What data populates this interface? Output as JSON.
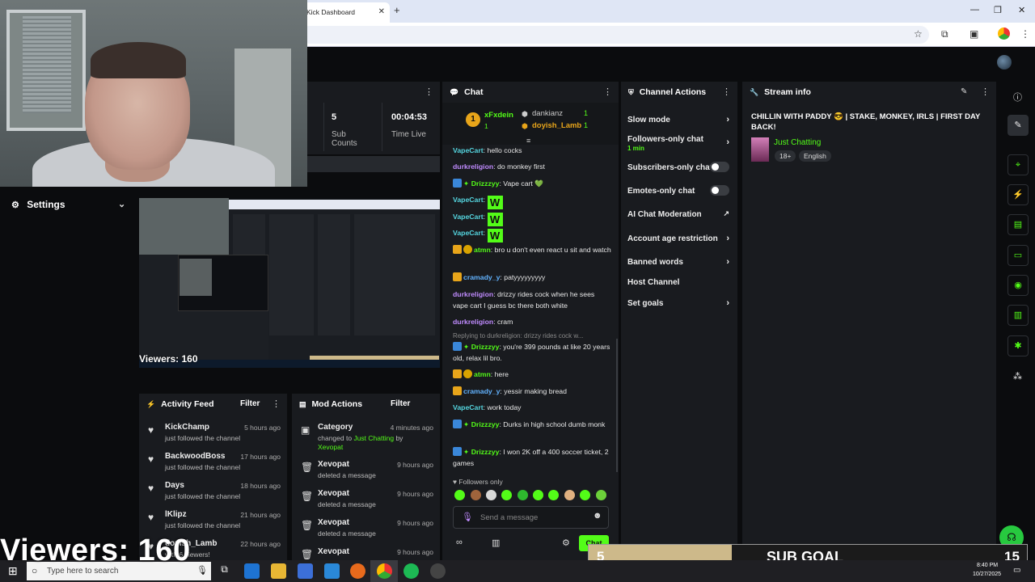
{
  "browser": {
    "tab_title": "Kick Dashboard",
    "tab_close": "✕",
    "new_tab": "+",
    "win_min": "—",
    "win_max": "❐",
    "win_close": "✕"
  },
  "settings": {
    "label": "Settings"
  },
  "preview": {
    "viewers": "Viewers: 160"
  },
  "stats": {
    "sub_counts_value": "5",
    "sub_counts_label": "Sub Counts",
    "time_live_value": "00:04:53",
    "time_live_label": "Time Live"
  },
  "activity": {
    "title": "Activity Feed",
    "filter": "Filter",
    "items": [
      {
        "name": "KickChamp",
        "sub": "just followed the channel",
        "time": "5 hours ago"
      },
      {
        "name": "BackwoodBoss",
        "sub": "just followed the channel",
        "time": "17 hours ago"
      },
      {
        "name": "Days",
        "sub": "just followed the channel",
        "time": "18 hours ago"
      },
      {
        "name": "lKlipz",
        "sub": "just followed the channel",
        "time": "21 hours ago"
      },
      {
        "name": "doyish_Lamb",
        "sub": "with 6 viewers!",
        "time": "22 hours ago"
      }
    ]
  },
  "mod": {
    "title": "Mod Actions",
    "filter": "Filter",
    "category": {
      "name": "Category",
      "time": "4 minutes ago",
      "pre": "changed to",
      "cat": "Just Chatting",
      "by": "by",
      "user": "Xevopat"
    },
    "items": [
      {
        "name": "Xevopat",
        "sub": "deleted a message",
        "time": "9 hours ago"
      },
      {
        "name": "Xevopat",
        "sub": "deleted a message",
        "time": "9 hours ago"
      },
      {
        "name": "Xevopat",
        "sub": "deleted a message",
        "time": "9 hours ago"
      },
      {
        "name": "Xevopat",
        "sub": "",
        "time": "9 hours ago"
      }
    ]
  },
  "chat": {
    "title": "Chat",
    "top_gifter": {
      "rank": "1",
      "name": "xFxdein",
      "count": "1"
    },
    "gifters": [
      {
        "name": "dankianz",
        "count": "1"
      },
      {
        "name": "doyish_Lamb",
        "count": "1"
      }
    ],
    "messages": [
      {
        "user": "VapeCart",
        "text": ": hello cocks"
      },
      {
        "user": "durkreligion",
        "text": ": do monkey first"
      },
      {
        "user": "Drizzzyy",
        "text": ": Vape cart 💚"
      },
      {
        "user": "VapeCart",
        "emote": "W"
      },
      {
        "user": "VapeCart",
        "emote": "W"
      },
      {
        "user": "VapeCart",
        "emote": "W"
      },
      {
        "user": "atmn",
        "text": ": bro u don't even react u sit and watch"
      },
      {
        "user": "cramady_y",
        "text": ": patyyyyyyyyy"
      },
      {
        "user": "durkreligion",
        "text": ": drizzy rides cock when he sees vape cart I guess bc there both white"
      },
      {
        "user": "durkreligion",
        "text": ": cram"
      },
      {
        "reply": "Replying to durkreligion: drizzy rides cock w..."
      },
      {
        "user": "Drizzzyy",
        "text": ": you're 399 pounds at like 20 years old, relax lil bro."
      },
      {
        "user": "atmn",
        "text": ": here"
      },
      {
        "user": "cramady_y",
        "text": ": yessir making bread"
      },
      {
        "user": "VapeCart",
        "text": ": work today"
      },
      {
        "user": "Drizzzyy",
        "text": ": Durks in high school dumb monk"
      },
      {
        "user": "Drizzzyy",
        "text": ": I won 2K off a 400 soccer ticket, 2 games"
      }
    ],
    "followers_only": "Followers only",
    "placeholder": "Send a message",
    "send": "Chat"
  },
  "channel_actions": {
    "title": "Channel Actions",
    "items": [
      {
        "label": "Slow mode",
        "control": "chevron"
      },
      {
        "label": "Followers-only chat",
        "sub": "1 min",
        "control": "chevron"
      },
      {
        "label": "Subscribers-only chat",
        "control": "toggle"
      },
      {
        "label": "Emotes-only chat",
        "control": "toggle"
      },
      {
        "label": "AI Chat Moderation",
        "control": "external"
      },
      {
        "label": "Account age restriction",
        "control": "chevron"
      },
      {
        "label": "Banned words",
        "control": "chevron"
      },
      {
        "label": "Host Channel",
        "control": "none"
      },
      {
        "label": "Set goals",
        "control": "chevron"
      }
    ]
  },
  "stream_info": {
    "title": "Stream info",
    "stream_title": "CHILLIN WITH PADDY 😎 | STAKE, MONKEY, IRLS | FIRST DAY BACK!",
    "category": "Just Chatting",
    "tags": [
      "18+",
      "English"
    ]
  },
  "overlay": {
    "sub_goal_current": "5",
    "sub_goal_label": "SUB GOAL",
    "sub_goal_target": "15",
    "viewers": "Viewers: 160"
  },
  "taskbar": {
    "search_placeholder": "Type here to search",
    "time": "8:40 PM",
    "date": "10/27/2025"
  },
  "colors": {
    "kick_green": "#53fc18",
    "panel_bg": "#191b1f",
    "sub_goal_fill": "#cdb98a"
  }
}
